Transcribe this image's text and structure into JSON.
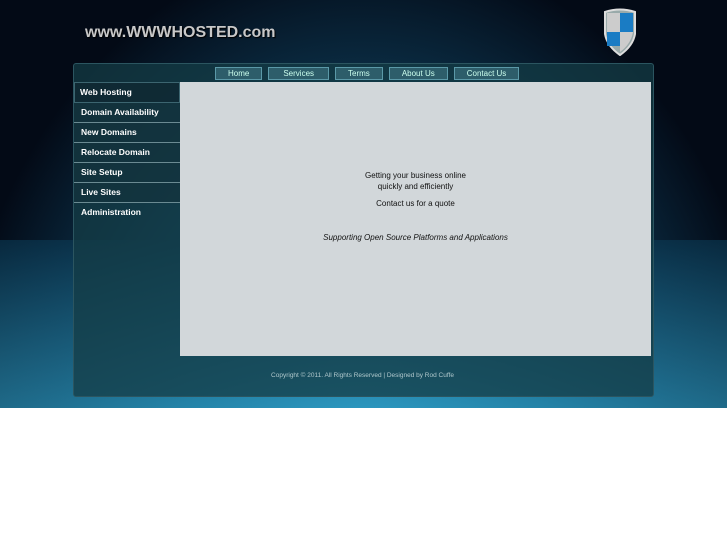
{
  "header": {
    "site_title": "www.WWWHOSTED.com"
  },
  "nav": [
    "Home",
    "Services",
    "Terms",
    "About Us",
    "Contact Us"
  ],
  "sidebar": [
    "Web Hosting",
    "Domain Availability",
    "New Domains",
    "Relocate Domain",
    "Site Setup",
    "Live Sites",
    "Administration"
  ],
  "main": {
    "line1": "Getting your business online",
    "line2": "quickly and efficiently",
    "line3": "Contact us for a quote",
    "tagline": "Supporting Open Source Platforms and Applications"
  },
  "footer": {
    "copyright": "Copyright © 2011. All Rights Reserved | Designed by Rod Cuffe"
  }
}
